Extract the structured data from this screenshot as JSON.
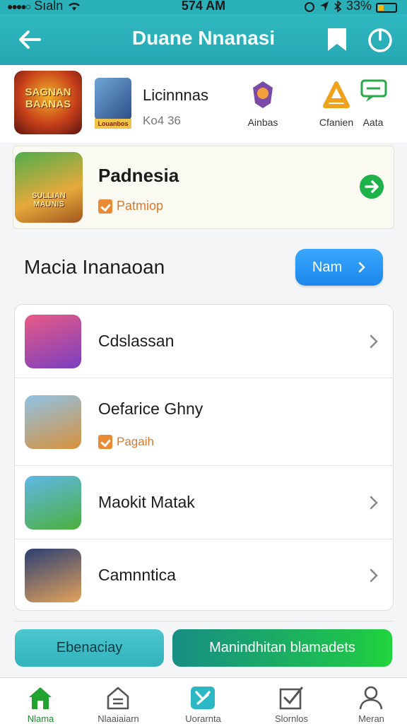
{
  "status_bar": {
    "carrier": "Sıaln",
    "time": "574 AM",
    "battery": "33%",
    "battery_level": 0.33
  },
  "header": {
    "title": "Duane Nnanasi",
    "back_icon": "arrow-left-icon",
    "bookmark_icon": "bookmark-icon",
    "power_icon": "power-icon"
  },
  "top_strip": {
    "logo_text": "SAGNAN BAANAS",
    "book_tag": "Louanbos",
    "name": "Licinnnas",
    "sub": "Ko4 36",
    "icons": [
      {
        "icon": "shield-icon",
        "label": "Ainbas"
      },
      {
        "icon": "helmet-icon",
        "label": "Cfanien"
      },
      {
        "icon": "chat-icon",
        "label": "Aata"
      }
    ]
  },
  "featured": {
    "title": "Padnesia",
    "subtitle": "Patmiop",
    "art_text": "SULLIAN MAUNIS",
    "go_icon": "arrow-right-circle-icon"
  },
  "section": {
    "title": "Macia Inanaoan",
    "more_label": "Nam"
  },
  "list": [
    {
      "title": "Cdslassan",
      "subtitle": "",
      "chevron": true,
      "colors": [
        "#e85a86",
        "#7a3fc0"
      ]
    },
    {
      "title": "Oefarice Ghny",
      "subtitle": "Pagaih",
      "chevron": false,
      "colors": [
        "#8fc3e6",
        "#d7913b"
      ]
    },
    {
      "title": "Maokit Matak",
      "subtitle": "",
      "chevron": true,
      "colors": [
        "#5fb8e8",
        "#4caf3c"
      ]
    },
    {
      "title": "Camnntica",
      "subtitle": "",
      "chevron": true,
      "colors": [
        "#2b3f73",
        "#e4a25a"
      ]
    }
  ],
  "actions": {
    "secondary_label": "Ebenaciay",
    "primary_label": "Manindhitan blamadets"
  },
  "tabs": [
    {
      "label": "Nlama",
      "icon": "home-icon",
      "active": true
    },
    {
      "label": "Nlaaiaiarn",
      "icon": "house-outline-icon",
      "active": false
    },
    {
      "label": "Uorarnta",
      "icon": "gamepad-icon",
      "active": false
    },
    {
      "label": "Slornlos",
      "icon": "checkbox-icon",
      "active": false
    },
    {
      "label": "Meran",
      "icon": "profile-icon",
      "active": false
    }
  ],
  "colors": {
    "header": "#2ab0b8",
    "accent_blue": "#1a86ea",
    "accent_green": "#1fb24a",
    "badge_orange": "#ea8a34"
  }
}
